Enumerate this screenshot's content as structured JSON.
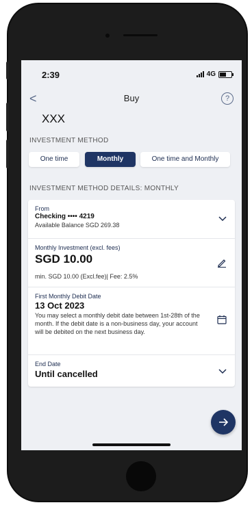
{
  "status_bar": {
    "time": "2:39",
    "network": "4G"
  },
  "nav": {
    "back_glyph": "<",
    "title": "Buy",
    "help_glyph": "?"
  },
  "fund_name": "XXX",
  "investment_method": {
    "label": "INVESTMENT METHOD",
    "options": [
      {
        "label": "One time",
        "selected": false
      },
      {
        "label": "Monthly",
        "selected": true
      },
      {
        "label": "One time and Monthly",
        "selected": false
      }
    ]
  },
  "details": {
    "label": "INVESTMENT METHOD DETAILS: MONTHLY",
    "from": {
      "label": "From",
      "account": "Checking •••• 4219",
      "balance": "Available Balance SGD 269.38"
    },
    "monthly_investment": {
      "label": "Monthly Investment (excl. fees)",
      "amount": "SGD  10.00",
      "hint": "min. SGD 10.00 (Excl.fee)| Fee: 2.5%"
    },
    "first_debit": {
      "label": "First Monthly Debit Date",
      "date": "13 Oct 2023",
      "note": "You may select a monthly debit date between 1st-28th of the month. If the debit date is a non-business day, your account will be debited on the next business day."
    },
    "end_date": {
      "label": "End Date",
      "value": "Until cancelled"
    }
  },
  "icons": {
    "back": "chevron-left-icon",
    "help": "question-circle-icon",
    "dropdown": "chevron-down-icon",
    "edit": "pencil-icon",
    "calendar": "calendar-icon",
    "next": "arrow-right-icon"
  },
  "colors": {
    "primary": "#1f3564",
    "background": "#eef0f4",
    "card": "#ffffff"
  }
}
